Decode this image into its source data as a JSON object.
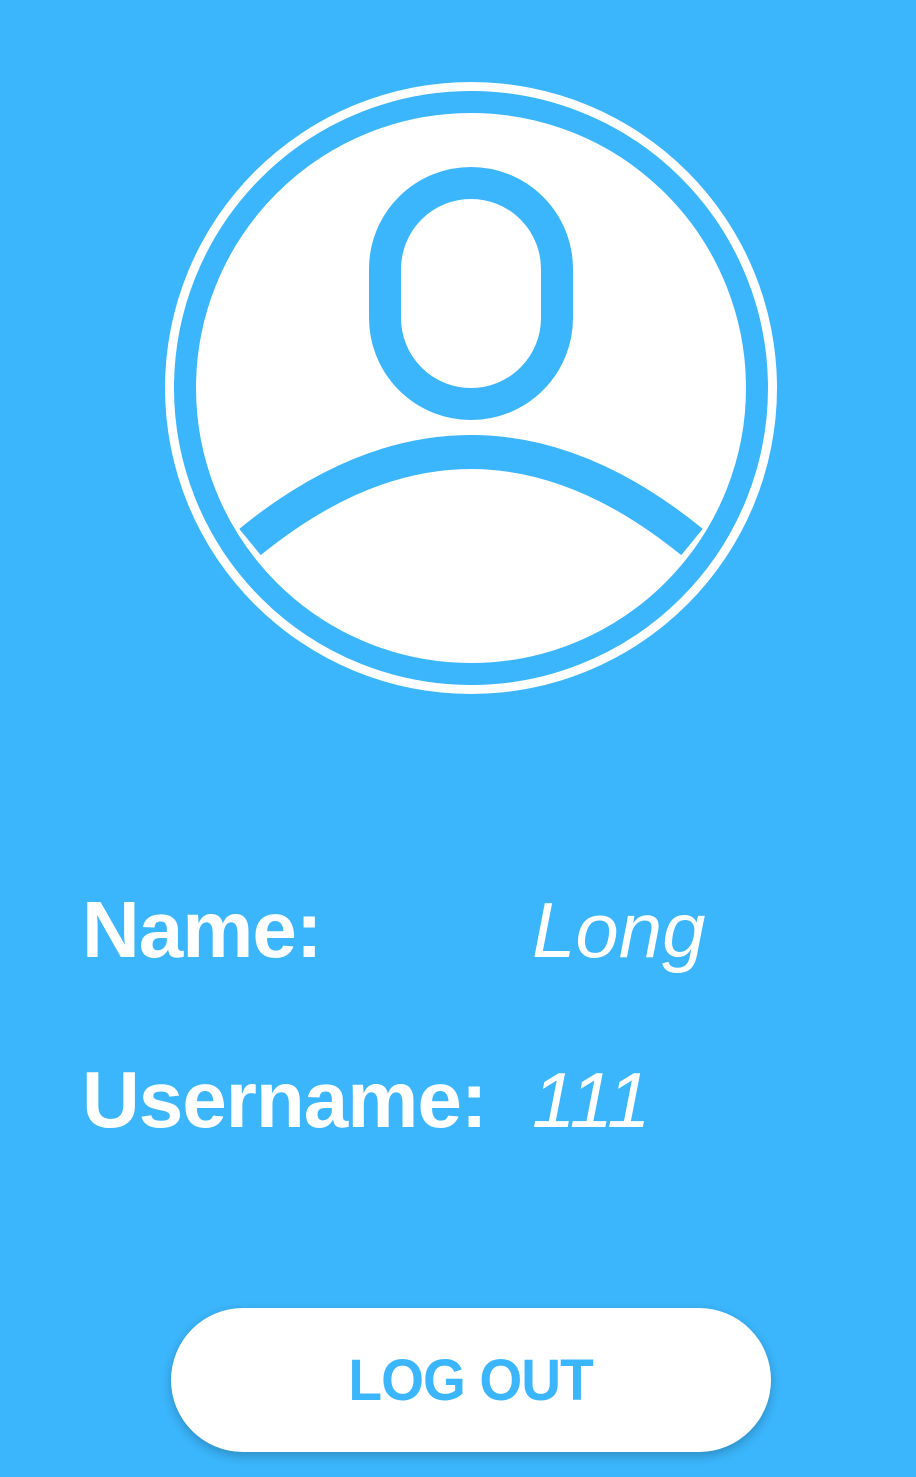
{
  "theme": {
    "background": "#3bb5fb",
    "accent": "#3bb5fb",
    "foreground": "#ffffff"
  },
  "avatar": {
    "icon": "user-profile-icon"
  },
  "profile": {
    "name_label": "Name:",
    "name_value": "Long",
    "username_label": "Username:",
    "username_value": "111"
  },
  "actions": {
    "logout_label": "LOG OUT"
  }
}
